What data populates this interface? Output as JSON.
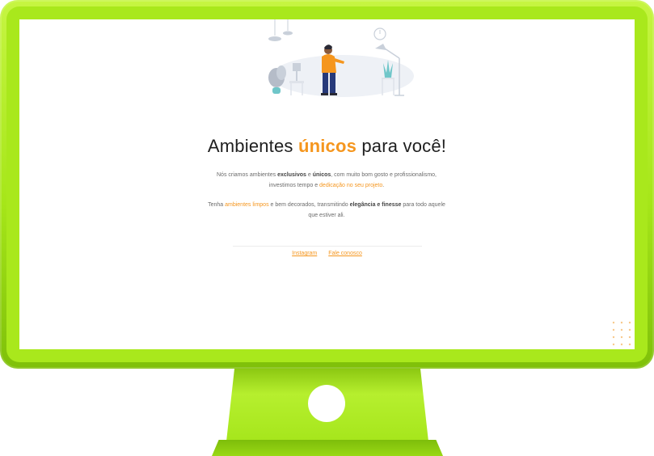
{
  "heading": {
    "before": "Ambientes ",
    "accent": "únicos",
    "after": " para você!"
  },
  "paragraph1": {
    "t1": "Nós criamos ambientes ",
    "b1": "exclusivos",
    "t2": " e ",
    "b2": "únicos",
    "t3": ", com muito bom gosto e profissionalismo, investimos tempo e ",
    "hl1": "dedicação no seu projeto",
    "t4": "."
  },
  "paragraph2": {
    "t1": "Tenha ",
    "hl1": "ambientes limpos",
    "t2": " e bem decorados, transmitindo ",
    "b1": "elegância e finesse",
    "t3": " para todo aquele que estiver ali."
  },
  "links": {
    "instagram": "Instagram",
    "contact": "Fale conosco"
  },
  "colors": {
    "accent": "#f5961e",
    "bezel": "#a6e619"
  },
  "icons": [
    "person-with-lamp-illustration",
    "dot-grid-decoration"
  ]
}
